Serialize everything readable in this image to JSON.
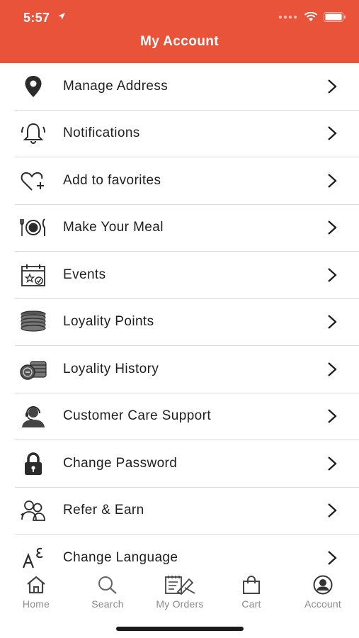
{
  "status_bar": {
    "time": "5:57"
  },
  "header": {
    "title": "My Account"
  },
  "menu": {
    "items": [
      {
        "label": "Manage Address",
        "icon": "location-pin-icon"
      },
      {
        "label": "Notifications",
        "icon": "bell-icon"
      },
      {
        "label": "Add to favorites",
        "icon": "heart-plus-icon"
      },
      {
        "label": "Make Your Meal",
        "icon": "plate-cutlery-icon"
      },
      {
        "label": "Events",
        "icon": "calendar-icon"
      },
      {
        "label": "Loyality Points",
        "icon": "coins-stack-icon"
      },
      {
        "label": "Loyality History",
        "icon": "coins-history-icon"
      },
      {
        "label": "Customer Care Support",
        "icon": "support-agent-icon"
      },
      {
        "label": "Change Password",
        "icon": "lock-icon"
      },
      {
        "label": "Refer & Earn",
        "icon": "refer-people-icon"
      },
      {
        "label": "Change Language",
        "icon": "language-icon"
      }
    ]
  },
  "tabbar": {
    "tabs": [
      {
        "label": "Home",
        "icon": "home-icon"
      },
      {
        "label": "Search",
        "icon": "search-icon"
      },
      {
        "label": "My Orders",
        "icon": "orders-icon"
      },
      {
        "label": "Cart",
        "icon": "cart-bag-icon"
      },
      {
        "label": "Account",
        "icon": "account-icon"
      }
    ]
  },
  "colors": {
    "accent": "#e8533a",
    "divider": "#d9d9d9",
    "tab_inactive": "#8a8a8a"
  }
}
